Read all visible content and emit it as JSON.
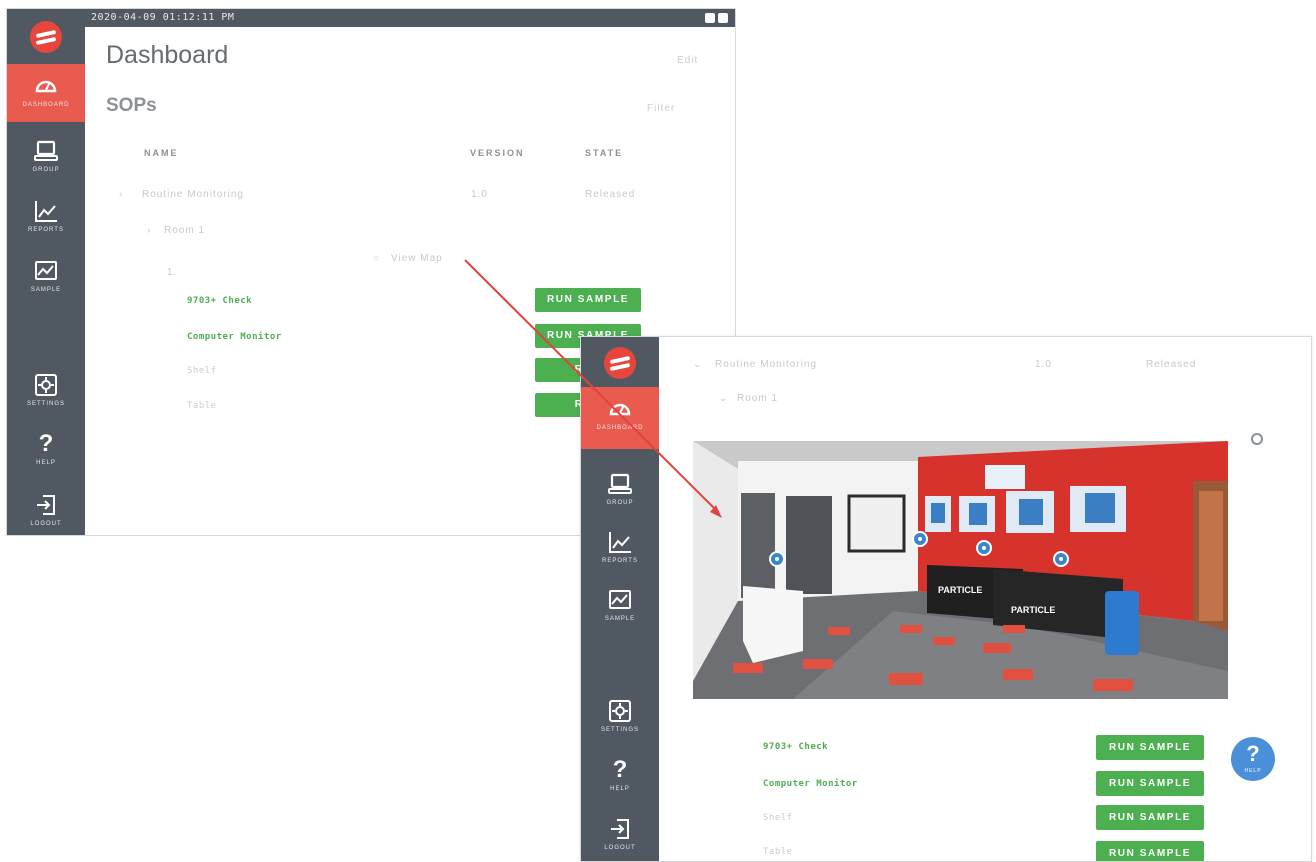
{
  "screen1": {
    "datetime": "2020-04-09 01:12:11 PM",
    "title": "Dashboard",
    "top_right_faint": "Edit",
    "section_title": "SOPs",
    "section_right_faint": "Filter",
    "columns": {
      "name": "NAME",
      "version": "VERSION",
      "state": "STATE"
    },
    "sop_row": {
      "name": "Routine Monitoring",
      "version": "1.0",
      "state": "Released"
    },
    "sub_row": "Room 1",
    "sub_index": "1.",
    "view_map": "View Map",
    "items": [
      {
        "name": "9703+ Check",
        "button": "RUN SAMPLE",
        "highlight": true
      },
      {
        "name": "Computer Monitor",
        "button": "RUN SAMPLE",
        "highlight": true
      },
      {
        "name": "Shelf",
        "button": "RUN",
        "highlight": false
      },
      {
        "name": "Table",
        "button": "RUN",
        "highlight": false
      }
    ]
  },
  "sidebar": {
    "items": [
      {
        "label": "DASHBOARD",
        "icon": "gauge-icon",
        "active": true
      },
      {
        "label": "GROUP",
        "icon": "laptop-icon",
        "active": false
      },
      {
        "label": "REPORTS",
        "icon": "line-chart-icon",
        "active": false
      },
      {
        "label": "SAMPLE",
        "icon": "image-chart-icon",
        "active": false
      },
      {
        "label": "SETTINGS",
        "icon": "settings-icon",
        "active": false
      },
      {
        "label": "HELP",
        "icon": "question-icon",
        "active": false
      },
      {
        "label": "LOGOUT",
        "icon": "logout-icon",
        "active": false
      }
    ]
  },
  "screen2": {
    "sop_row": {
      "name": "Routine Monitoring",
      "version": "1.0",
      "state": "Released"
    },
    "sub_row": "Room 1",
    "items": [
      {
        "name": "9703+ Check",
        "button": "RUN SAMPLE",
        "highlight": true
      },
      {
        "name": "Computer Monitor",
        "button": "RUN SAMPLE",
        "highlight": true
      },
      {
        "name": "Shelf",
        "button": "RUN SAMPLE",
        "highlight": false
      },
      {
        "name": "Table",
        "button": "RUN SAMPLE",
        "highlight": false
      }
    ],
    "help_bubble": {
      "symbol": "?",
      "label": "HELP"
    },
    "photo_sign_1": "PARTICLE",
    "photo_sign_2": "PARTICLE"
  },
  "colors": {
    "sidebar": "#505962",
    "active": "#e95a4f",
    "button": "#4caf50",
    "accent_red": "#e8453c",
    "help_blue": "#4a90d9"
  }
}
